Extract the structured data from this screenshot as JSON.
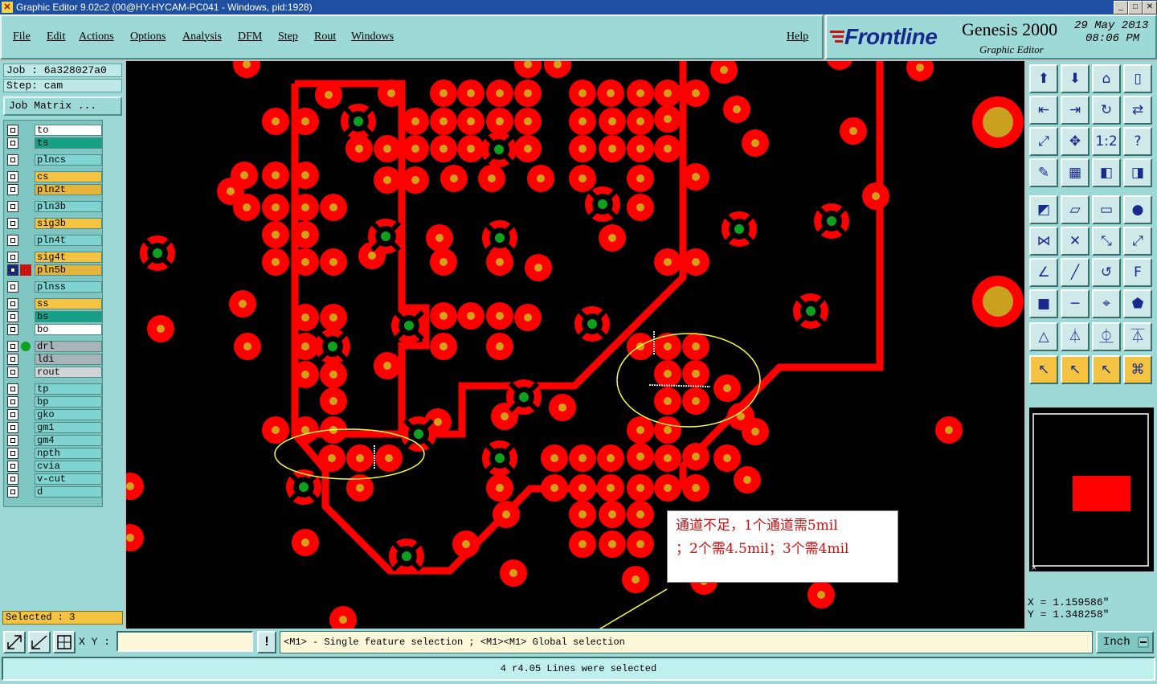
{
  "window": {
    "title": "Graphic Editor 9.02c2 (00@HY-HYCAM-PC041 - Windows, pid:1928)",
    "btn_min": "_",
    "btn_max": "□",
    "btn_close": "✕"
  },
  "menu": {
    "items": [
      "File",
      "Edit",
      "Actions",
      "Options",
      "Analysis",
      "DFM",
      "Step",
      "Rout",
      "Windows"
    ],
    "help": "Help"
  },
  "brand": {
    "logo": "Frontline",
    "product": "Genesis 2000",
    "subtitle": "Graphic Editor",
    "date": "29 May 2013",
    "time": "08:06 PM"
  },
  "job": {
    "job_line": "Job : 6a328027a0",
    "step_line": "Step: cam",
    "matrix_button": "Job Matrix ..."
  },
  "layers": [
    {
      "name": "to",
      "bg": "#ffffff"
    },
    {
      "name": "ts",
      "bg": "#16a085"
    },
    {
      "name": "plncs",
      "bg": "#7fd3d0"
    },
    {
      "name": "cs",
      "bg": "#f5c342"
    },
    {
      "name": "pln2t",
      "bg": "#e5b43a"
    },
    {
      "name": "pln3b",
      "bg": "#7fd3d0"
    },
    {
      "name": "sig3b",
      "bg": "#f5c342"
    },
    {
      "name": "pln4t",
      "bg": "#7fd3d0"
    },
    {
      "name": "sig4t",
      "bg": "#f5c342"
    },
    {
      "name": "pln5b",
      "bg": "#e5b43a"
    },
    {
      "name": "plnss",
      "bg": "#7fd3d0"
    },
    {
      "name": "ss",
      "bg": "#f5c342"
    },
    {
      "name": "bs",
      "bg": "#16a085"
    },
    {
      "name": "bo",
      "bg": "#ffffff"
    },
    {
      "name": "drl",
      "bg": "#a9b4b8"
    },
    {
      "name": "ldi",
      "bg": "#a9b4b8"
    },
    {
      "name": "rout",
      "bg": "#d0d4d6"
    },
    {
      "name": "tp",
      "bg": "#7fd3d0"
    },
    {
      "name": "bp",
      "bg": "#7fd3d0"
    },
    {
      "name": "gko",
      "bg": "#7fd3d0"
    },
    {
      "name": "gm1",
      "bg": "#7fd3d0"
    },
    {
      "name": "gm4",
      "bg": "#7fd3d0"
    },
    {
      "name": "npth",
      "bg": "#7fd3d0"
    },
    {
      "name": "cvia",
      "bg": "#7fd3d0"
    },
    {
      "name": "v-cut",
      "bg": "#7fd3d0"
    },
    {
      "name": "d",
      "bg": "#7fd3d0"
    }
  ],
  "selected": "Selected : 3",
  "coords": {
    "x": "X  =  1.159586\"",
    "y": "Y  =  1.348258\""
  },
  "bottom": {
    "xy_label": "X Y :",
    "xy_value": "",
    "bang": "!",
    "hint": "<M1> - Single feature selection ; <M1><M1> Global selection",
    "units": "Inch",
    "status": "4 r4.05 Lines were selected"
  },
  "annotation": {
    "line1": "通道不足，1个通道需5mil",
    "line2": "；2个需4.5mil；3个需4mil"
  },
  "colors": {
    "pad": "#ff0000",
    "pad_center": "#d4a017",
    "via_center": "#10a020",
    "highlight_ellipse": "#ffff40",
    "canvas_bg": "#000000"
  }
}
